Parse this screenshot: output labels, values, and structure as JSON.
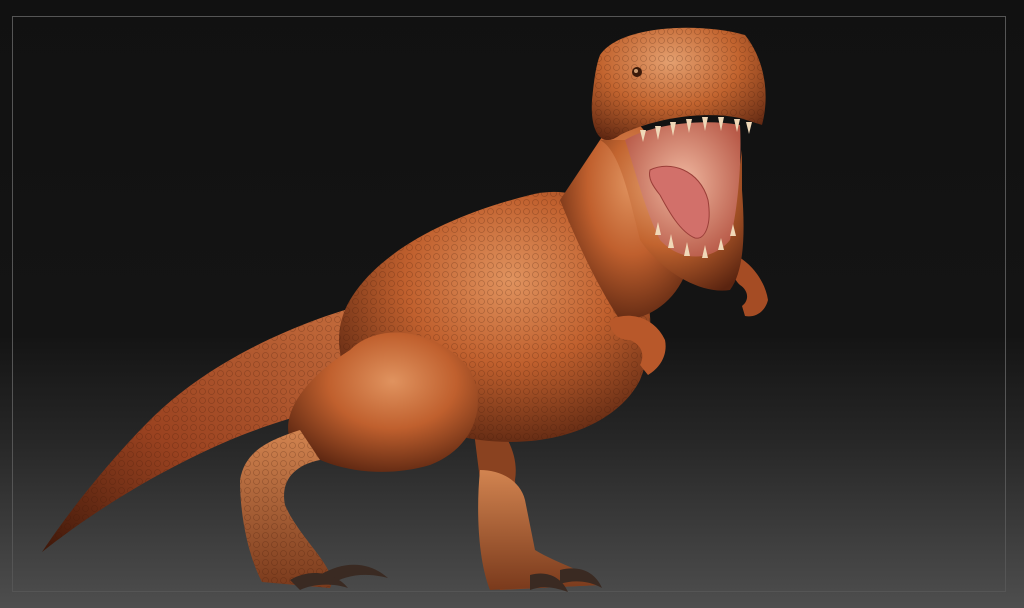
{
  "scene": {
    "subject": "t-rex-sculpt",
    "colors": {
      "background_top": "#111111",
      "background_bottom": "#4e4e4e",
      "frame_border": "#555555",
      "skin_light": "#d98a58",
      "skin_mid": "#b8552a",
      "skin_dark": "#5a2410",
      "mouth": "#e8a58a",
      "tongue": "#d2706a",
      "teeth": "#f0d8b8",
      "claw": "#3a2a22"
    }
  }
}
